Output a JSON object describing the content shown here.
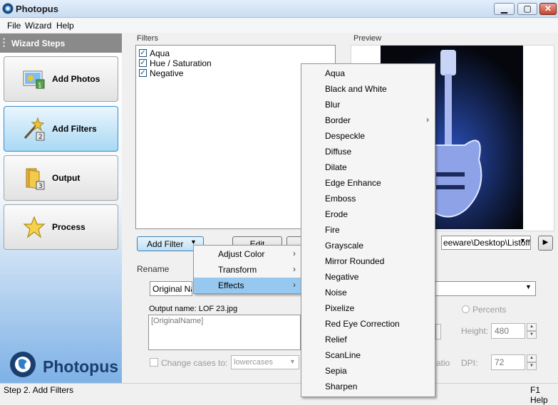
{
  "app": {
    "title": "Photopus"
  },
  "menu": {
    "file": "File",
    "wizard": "Wizard",
    "help": "Help"
  },
  "sidebar": {
    "title": "Wizard Steps",
    "steps": [
      {
        "label": "Add Photos"
      },
      {
        "label": "Add Filters",
        "active": true
      },
      {
        "label": "Output"
      },
      {
        "label": "Process"
      }
    ],
    "logo_text": "Photopus"
  },
  "filters": {
    "group_label": "Filters",
    "items": [
      {
        "label": "Aqua",
        "checked": true
      },
      {
        "label": "Hue / Saturation",
        "checked": true
      },
      {
        "label": "Negative",
        "checked": true
      }
    ],
    "add_filter_label": "Add Filter",
    "edit_label": "Edit"
  },
  "preview": {
    "group_label": "Preview",
    "path": "eeware\\Desktop\\Listoffr"
  },
  "rename": {
    "group_label": "Rename",
    "input_value": "Original Nam",
    "output_name_label": "Output name:",
    "output_name_value": "LOF 23.jpg",
    "template_text": "[OriginalName]",
    "change_cases_label": "Change cases to:",
    "change_cases_value": "lowercases",
    "percents_label": "Percents",
    "height_label": "Height:",
    "height_value": "480",
    "dpi_label": "DPI:",
    "dpi_value": "72",
    "ratio_fragment": "atio"
  },
  "status": {
    "left": "Step 2. Add Filters",
    "right": "F1 Help"
  },
  "context_menu": {
    "items": [
      {
        "label": "Adjust Color"
      },
      {
        "label": "Transform"
      },
      {
        "label": "Effects",
        "selected": true
      }
    ]
  },
  "effects_menu": {
    "items": [
      "Aqua",
      "Black and White",
      "Blur",
      "Border",
      "Despeckle",
      "Diffuse",
      "Dilate",
      "Edge Enhance",
      "Emboss",
      "Erode",
      "Fire",
      "Grayscale",
      "Mirror Rounded",
      "Negative",
      "Noise",
      "Pixelize",
      "Red Eye Correction",
      "Relief",
      "ScanLine",
      "Sepia",
      "Sharpen"
    ]
  },
  "colors": {
    "selection": "#97c8f0",
    "accent": "#3c8bc7",
    "logo": "#1a3f6e"
  }
}
